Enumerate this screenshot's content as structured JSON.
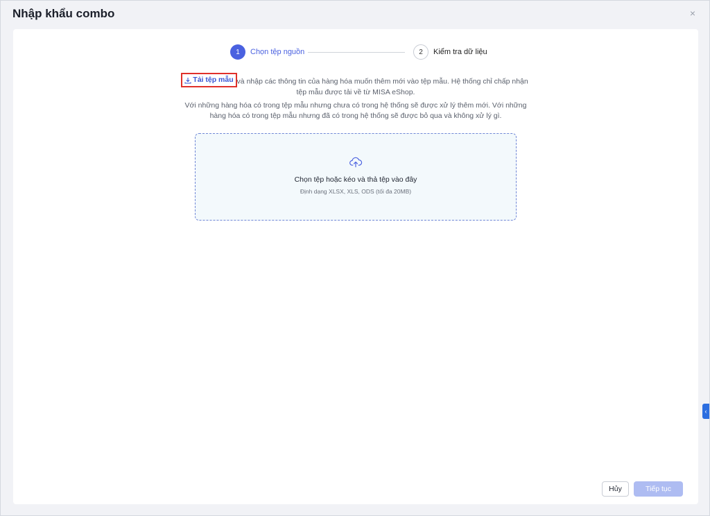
{
  "dialog": {
    "title": "Nhập khẩu combo",
    "close_icon": "close-icon",
    "close_glyph": "×"
  },
  "stepper": {
    "steps": [
      {
        "number": "1",
        "label": "Chọn tệp nguồn",
        "active": true
      },
      {
        "number": "2",
        "label": "Kiểm tra dữ liệu",
        "active": false
      }
    ]
  },
  "instructions": {
    "download_link": "Tải tệp mẫu",
    "line1_rest": " và nhập các thông tin của hàng hóa muốn thêm mới vào tệp mẫu. Hệ thống chỉ chấp nhận tệp mẫu được tải về từ MISA eShop.",
    "line2": "Với những hàng hóa có trong tệp mẫu nhưng chưa có trong hệ thống sẽ được xử lý thêm mới. Với những hàng hóa có trong tệp mẫu nhưng đã có trong hệ thống sẽ được bỏ qua và không xử lý gì."
  },
  "dropzone": {
    "icon": "cloud-upload-icon",
    "title": "Chọn tệp hoặc kéo và thả tệp vào đây",
    "subtitle": "Định dạng XLSX, XLS, ODS (tối đa 20MB)"
  },
  "footer": {
    "cancel_label": "Hủy",
    "next_label": "Tiếp tục"
  },
  "side_tab": {
    "icon": "chevron-left-icon",
    "glyph": "‹"
  },
  "colors": {
    "primary": "#4a61e0",
    "highlight_box": "#e0302a",
    "disabled_button": "#aebcf2"
  }
}
